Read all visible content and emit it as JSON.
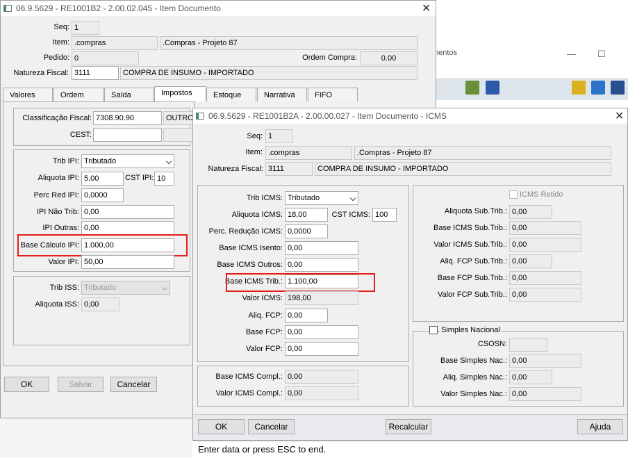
{
  "background": {
    "title": "mentos",
    "min": "—",
    "max": "☐"
  },
  "win1": {
    "title": "06.9.5629 - RE1001B2 - 2.00.02.045 - Item Documento",
    "close": "✕",
    "header": {
      "seq_label": "Seq:",
      "seq": "1",
      "item_label": "Item:",
      "item_code": ".compras",
      "item_desc": ".Compras - Projeto 87",
      "pedido_label": "Pedido:",
      "pedido": "0",
      "ordem_label": "Ordem Compra:",
      "ordem": "0.00",
      "natureza_label": "Natureza Fiscal:",
      "natureza_code": "3111",
      "natureza_desc": "COMPRA DE INSUMO - IMPORTADO"
    },
    "tabs": [
      "Valores",
      "Ordem",
      "Saída",
      "Impostos",
      "Estoque",
      "Narrativa",
      "FIFO"
    ],
    "impostos": {
      "class_label": "Classificação Fiscal:",
      "class_value": "7308.90.90",
      "class_extra": "OUTROS",
      "cest_label": "CEST:",
      "cest": "",
      "trib_ipi_label": "Trib IPI:",
      "trib_ipi": "Tributado",
      "aliq_ipi_label": "Aliquota IPI:",
      "aliq_ipi": "5,00",
      "cst_ipi_label": "CST IPI:",
      "cst_ipi": "10",
      "perc_red_label": "Perc Red IPI:",
      "perc_red": "0,0000",
      "nao_trib_label": "IPI Não Trib:",
      "nao_trib": "0,00",
      "outras_label": "IPI Outras:",
      "outras": "0,00",
      "base_label": "Base Cálculo IPI:",
      "base": "1.000,00",
      "valor_label": "Valor IPI:",
      "valor": "50,00",
      "trib_iss_label": "Trib ISS:",
      "trib_iss": "Tributado",
      "aliq_iss_label": "Aliquota ISS:",
      "aliq_iss": "0,00"
    },
    "buttons": {
      "ok": "OK",
      "salvar": "Salvar",
      "cancelar": "Cancelar"
    }
  },
  "win2": {
    "title": "06.9.5629 - RE1001B2A - 2.00.00.027 - Item Documento - ICMS",
    "close": "✕",
    "header": {
      "seq_label": "Seq:",
      "seq": "1",
      "item_label": "Item:",
      "item_code": ".compras",
      "item_desc": ".Compras - Projeto 87",
      "natureza_label": "Natureza Fiscal:",
      "natureza_code": "3111",
      "natureza_desc": "COMPRA DE INSUMO - IMPORTADO"
    },
    "icms": {
      "trib_label": "Trib ICMS:",
      "trib": "Tributado",
      "aliq_label": "Aliquota ICMS:",
      "aliq": "18,00",
      "cst_label": "CST ICMS:",
      "cst": "100",
      "perc_red_label": "Perc. Redução ICMS:",
      "perc_red": "0,0000",
      "isento_label": "Base ICMS Isento:",
      "isento": "0,00",
      "outros_label": "Base ICMS Outros:",
      "outros": "0,00",
      "base_trib_label": "Base ICMS Trib.:",
      "base_trib": "1.100,00",
      "valor_label": "Valor ICMS:",
      "valor": "198,00",
      "aliq_fcp_label": "Aliq. FCP:",
      "aliq_fcp": "0,00",
      "base_fcp_label": "Base FCP:",
      "base_fcp": "0,00",
      "valor_fcp_label": "Valor FCP:",
      "valor_fcp": "0,00"
    },
    "compl": {
      "base_label": "Base ICMS Compl.:",
      "base": "0,00",
      "valor_label": "Valor ICMS Compl.:",
      "valor": "0,00"
    },
    "st": {
      "retido_label": "ICMS Retido",
      "aliq_label": "Aliquota Sub.Trib.:",
      "aliq": "0,00",
      "base_label": "Base ICMS Sub.Trib.:",
      "base": "0,00",
      "valor_label": "Valor ICMS Sub.Trib.:",
      "valor": "0,00",
      "aliq_fcp_label": "Aliq. FCP Sub.Trib.:",
      "aliq_fcp": "0,00",
      "base_fcp_label": "Base FCP Sub.Trib.:",
      "base_fcp": "0,00",
      "valor_fcp_label": "Valor FCP Sub.Trib.:",
      "valor_fcp": "0,00"
    },
    "simples": {
      "title": "Simples Nacional",
      "csosn_label": "CSOSN:",
      "csosn": "",
      "base_label": "Base Simples Nac.:",
      "base": "0,00",
      "aliq_label": "Aliq. Simples Nac.:",
      "aliq": "0,00",
      "valor_label": "Valor Simples Nac.:",
      "valor": "0,00"
    },
    "buttons": {
      "ok": "OK",
      "cancelar": "Cancelar",
      "recalcular": "Recalcular",
      "ajuda": "Ajuda"
    },
    "status": "Enter data or press ESC to end."
  }
}
